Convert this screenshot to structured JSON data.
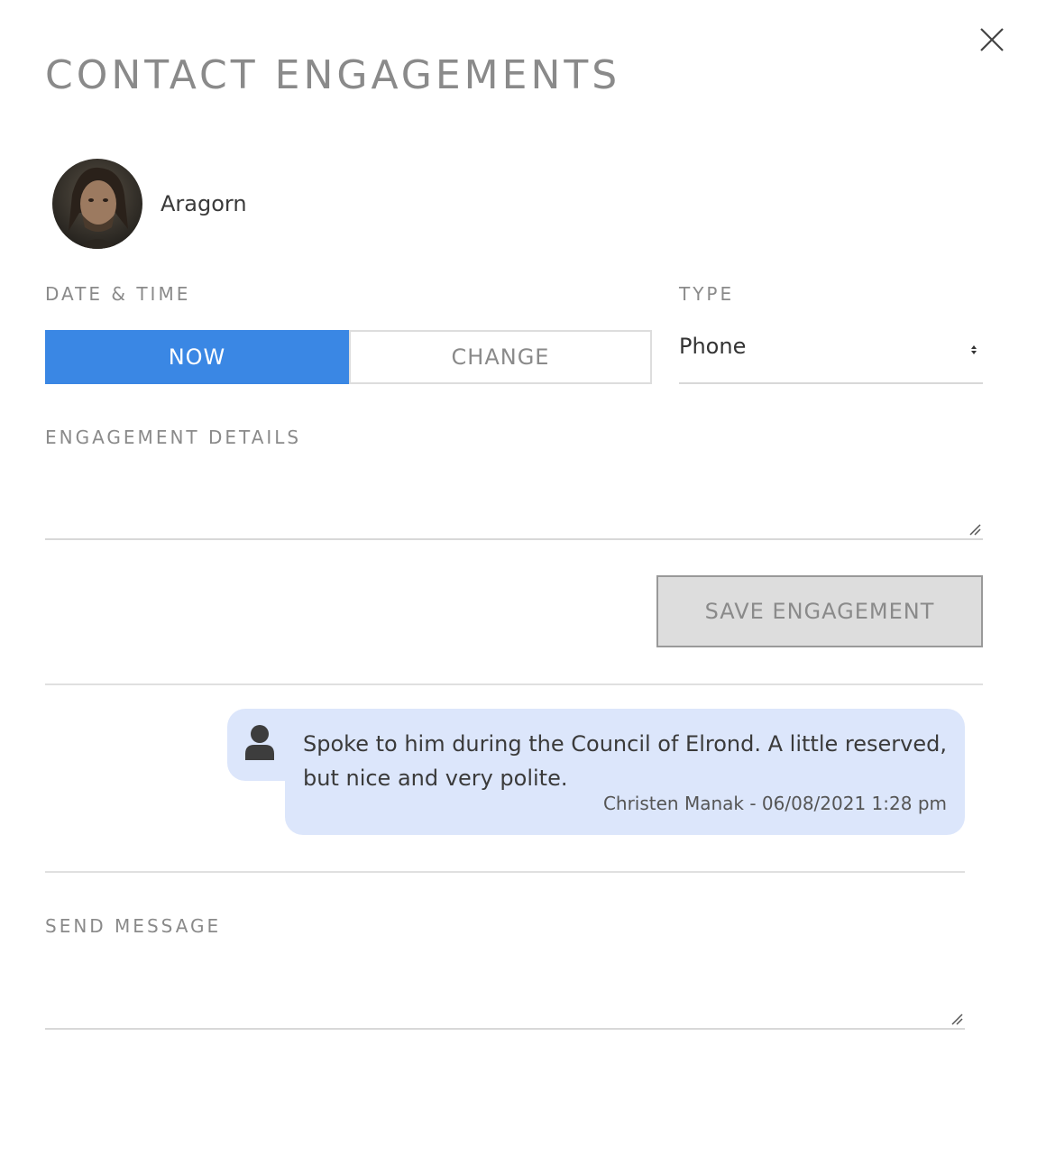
{
  "modal": {
    "title": "CONTACT ENGAGEMENTS",
    "close_icon": "close-icon"
  },
  "contact": {
    "name": "Aragorn",
    "avatar": "contact-avatar-photo"
  },
  "form": {
    "datetime_label": "DATE & TIME",
    "now_label": "NOW",
    "change_label": "CHANGE",
    "type_label": "TYPE",
    "type_value": "Phone",
    "details_label": "ENGAGEMENT DETAILS",
    "details_value": "",
    "save_label": "SAVE ENGAGEMENT"
  },
  "engagements": [
    {
      "icon": "user-icon",
      "text": "Spoke to him during the Council of Elrond. A little reserved, but nice and very polite.",
      "author_and_time": "Christen Manak - 06/08/2021 1:28 pm"
    }
  ],
  "message": {
    "label": "SEND MESSAGE",
    "value": ""
  },
  "colors": {
    "accent": "#3a87e4",
    "bubble": "#dce6fb",
    "muted_text": "#8a8a8a",
    "button_disabled": "#dddddd"
  }
}
